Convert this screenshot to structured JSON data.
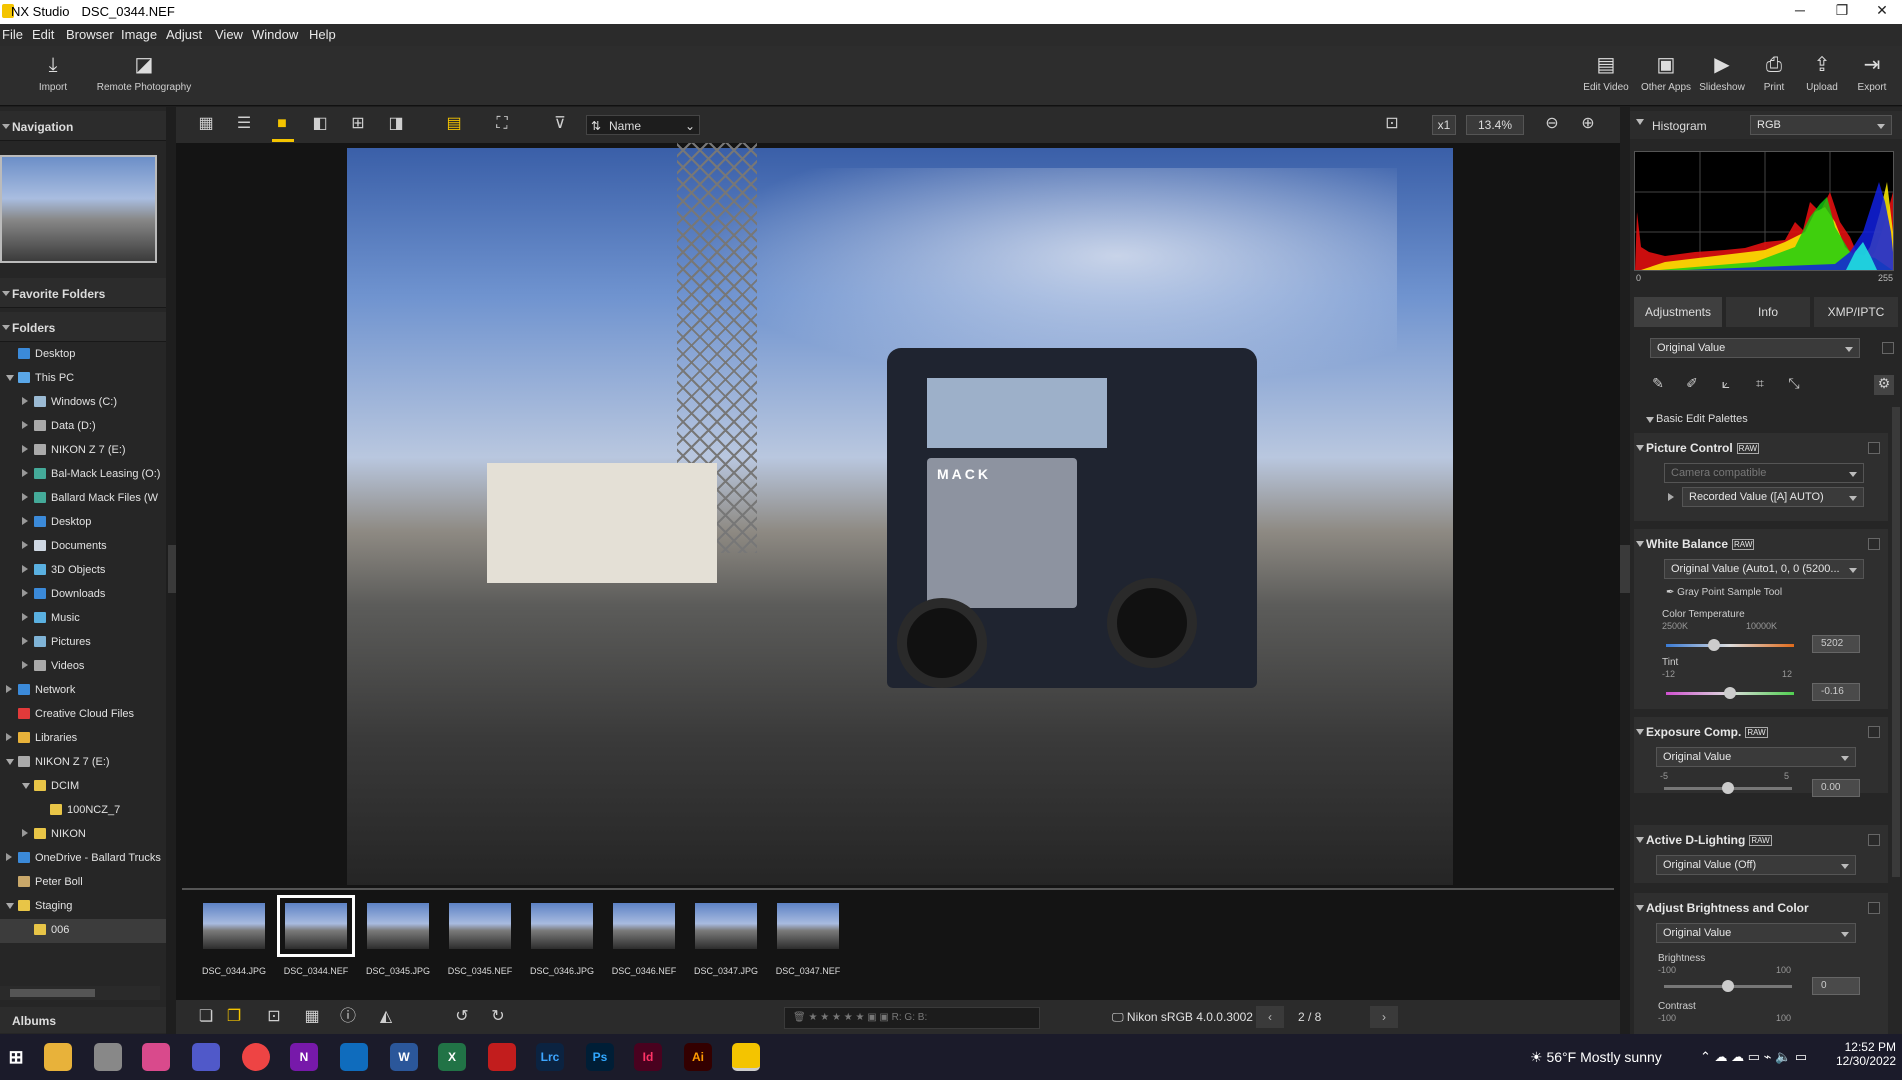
{
  "window": {
    "app_name": "NX Studio",
    "file_name": "DSC_0344.NEF",
    "minimize": "─",
    "maximize": "❐",
    "close": "✕"
  },
  "menu": [
    "File",
    "Edit",
    "Browser",
    "Image",
    "Adjust",
    "View",
    "Window",
    "Help"
  ],
  "toolbar": {
    "import": "Import",
    "remote": "Remote Photography",
    "edit_video": "Edit Video",
    "other_apps": "Other Apps",
    "slideshow": "Slideshow",
    "print": "Print",
    "upload": "Upload",
    "export": "Export"
  },
  "left": {
    "navigation": "Navigation",
    "favorite_folders": "Favorite Folders",
    "folders": "Folders",
    "albums": "Albums",
    "tree": [
      {
        "label": "Desktop",
        "icon": "desktop-icon"
      },
      {
        "label": "This PC",
        "icon": "computer-icon"
      },
      {
        "label": "Windows (C:)",
        "icon": "drive-icon"
      },
      {
        "label": "Data (D:)",
        "icon": "drive-icon"
      },
      {
        "label": "NIKON Z 7   (E:)",
        "icon": "drive-icon"
      },
      {
        "label": "Bal-Mack Leasing (O:)",
        "icon": "network-drive-icon"
      },
      {
        "label": "Ballard Mack Files (W",
        "icon": "network-drive-icon"
      },
      {
        "label": "Desktop",
        "icon": "desktop-icon"
      },
      {
        "label": "Documents",
        "icon": "documents-icon"
      },
      {
        "label": "3D Objects",
        "icon": "3d-objects-icon"
      },
      {
        "label": "Downloads",
        "icon": "downloads-icon"
      },
      {
        "label": "Music",
        "icon": "music-icon"
      },
      {
        "label": "Pictures",
        "icon": "pictures-icon"
      },
      {
        "label": "Videos",
        "icon": "videos-icon"
      },
      {
        "label": "Network",
        "icon": "network-icon"
      },
      {
        "label": "Creative Cloud Files",
        "icon": "creative-cloud-icon"
      },
      {
        "label": "Libraries",
        "icon": "libraries-icon"
      },
      {
        "label": "NIKON Z 7   (E:)",
        "icon": "drive-icon"
      },
      {
        "label": "DCIM",
        "icon": "folder-icon"
      },
      {
        "label": "100NCZ_7",
        "icon": "folder-icon"
      },
      {
        "label": "NIKON",
        "icon": "folder-icon"
      },
      {
        "label": "OneDrive - Ballard Trucks",
        "icon": "onedrive-icon"
      },
      {
        "label": "Peter Boll",
        "icon": "user-folder-icon"
      },
      {
        "label": "Staging",
        "icon": "folder-icon"
      },
      {
        "label": "006",
        "icon": "folder-icon"
      }
    ]
  },
  "center": {
    "sort_label": "Name",
    "zoom_mult": "x1",
    "zoom_percent": "13.4%",
    "thumbnails": [
      "DSC_0344.JPG",
      "DSC_0344.NEF",
      "DSC_0345.JPG",
      "DSC_0345.NEF",
      "DSC_0346.JPG",
      "DSC_0346.NEF",
      "DSC_0347.JPG",
      "DSC_0347.NEF"
    ],
    "selected_index": 1,
    "rgb_readout": "R:        G:        B:",
    "color_profile": "Nikon sRGB 4.0.0.3002",
    "page_count": "2 / 8",
    "truck_brand": "MACK"
  },
  "right": {
    "histogram_title": "Histogram",
    "histogram_channel": "RGB",
    "hist_min": "0",
    "hist_max": "255",
    "tabs": [
      "Adjustments",
      "Info",
      "XMP/IPTC"
    ],
    "preset": "Original Value",
    "basic_palettes": "Basic Edit Palettes",
    "picture_control": {
      "title": "Picture Control",
      "compat": "Camera compatible",
      "value": "Recorded Value ([A] AUTO)"
    },
    "white_balance": {
      "title": "White Balance",
      "value": "Original Value (Auto1, 0, 0 (5200...",
      "gray_point": "Gray Point Sample Tool",
      "temp_label": "Color Temperature",
      "temp_min": "2500K",
      "temp_max": "10000K",
      "temp_value": "5202",
      "tint_label": "Tint",
      "tint_min": "-12",
      "tint_max": "12",
      "tint_value": "-0.16"
    },
    "exposure": {
      "title": "Exposure Comp.",
      "value": "Original Value",
      "min": "-5",
      "max": "5",
      "amount": "0.00"
    },
    "adl": {
      "title": "Active D-Lighting",
      "value": "Original Value (Off)"
    },
    "brightness_color": {
      "title": "Adjust Brightness and Color",
      "value": "Original Value",
      "brightness_label": "Brightness",
      "b_min": "-100",
      "b_max": "100",
      "b_value": "0",
      "contrast_label": "Contrast",
      "c_min": "-100",
      "c_max": "100"
    },
    "raw_badge": "RAW"
  },
  "taskbar": {
    "weather": "56°F   Mostly sunny",
    "time": "12:52 PM",
    "date": "12/30/2022",
    "apps": [
      "N",
      "W",
      "X",
      "Lrc",
      "Ps",
      "Id",
      "Ai"
    ]
  },
  "colors": {
    "accent_yellow": "#f4c400",
    "panel": "#262626",
    "selection": "#ffffff"
  }
}
